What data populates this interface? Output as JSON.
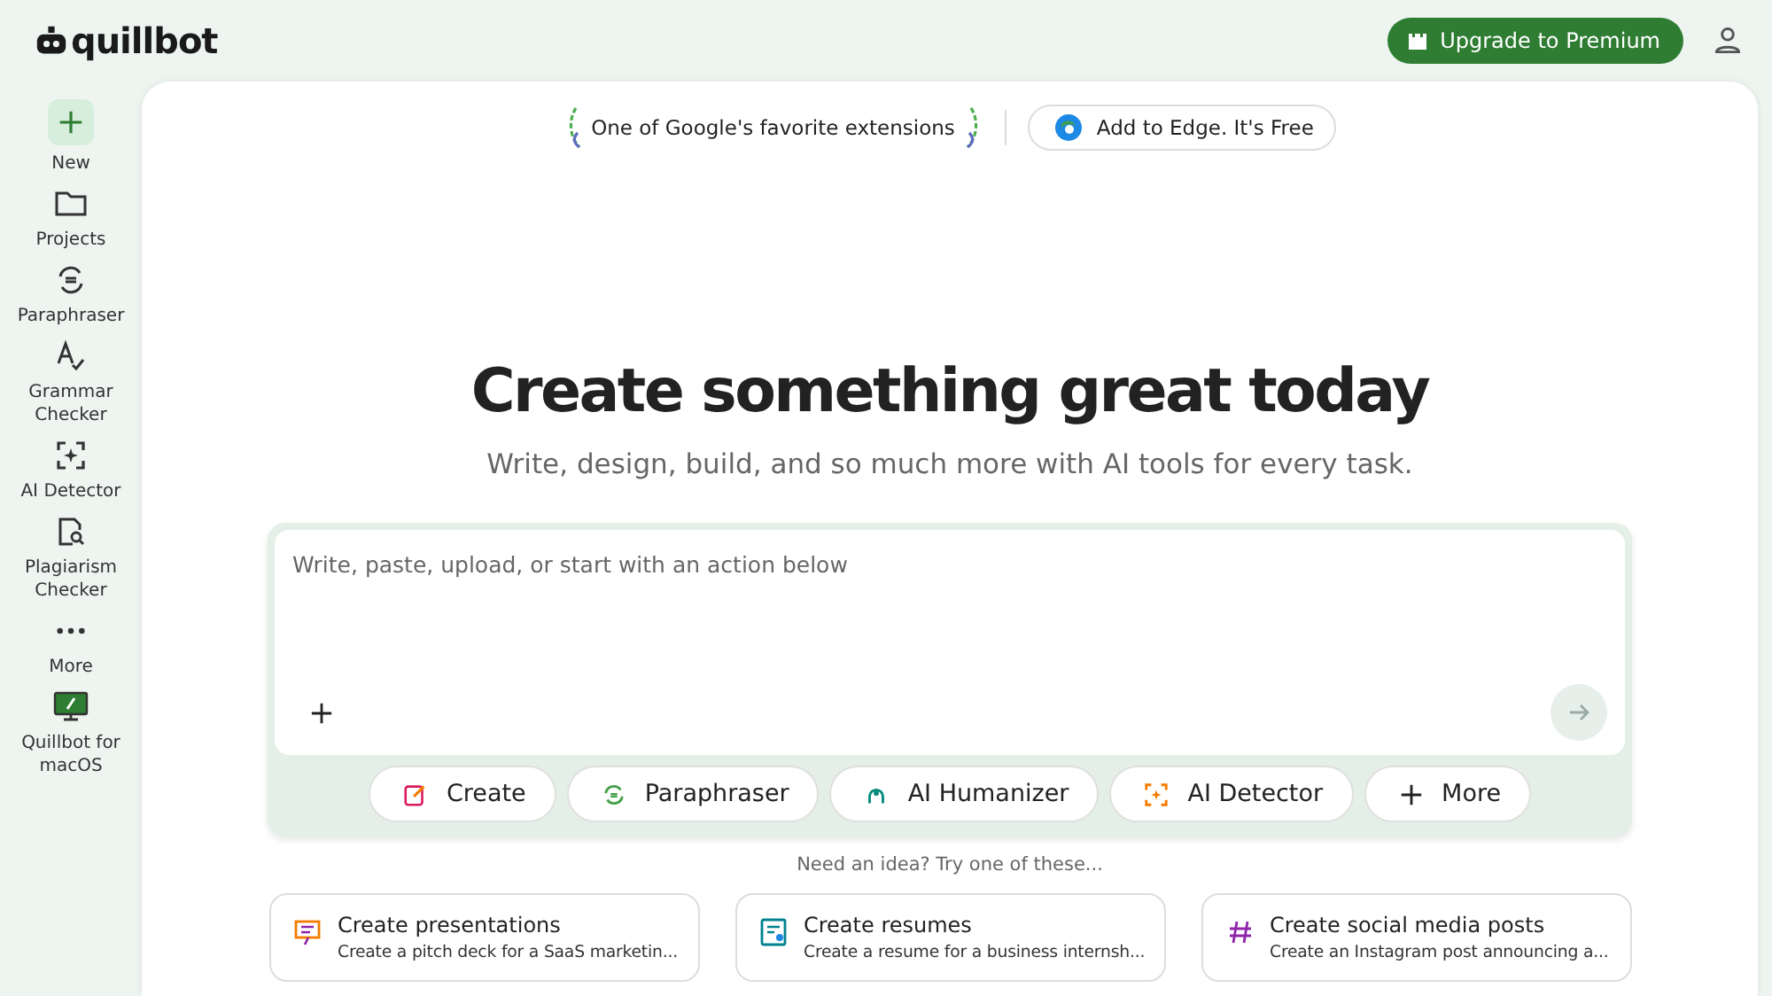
{
  "header": {
    "logo": "quillbot",
    "upgrade_button": "Upgrade to Premium"
  },
  "sidebar": {
    "items": [
      {
        "kind": "new",
        "label": "New"
      },
      {
        "kind": "folder",
        "label": "Projects"
      },
      {
        "kind": "paraphraser",
        "label": "Paraphraser"
      },
      {
        "kind": "grammar",
        "label": "Grammar Checker"
      },
      {
        "kind": "detector",
        "label": "AI Detector"
      },
      {
        "kind": "plagiarism",
        "label": "Plagiarism Checker"
      },
      {
        "kind": "more",
        "label": "More"
      },
      {
        "kind": "desktop",
        "label": "Quillbot for macOS"
      }
    ]
  },
  "banner": {
    "award": "One of Google's favorite extensions",
    "extension_button": "Add to Edge. It's Free"
  },
  "hero": {
    "title": "Create something great today",
    "subtitle": "Write, design, build, and so much more with AI tools for every task."
  },
  "prompt": {
    "placeholder": "Write, paste, upload, or start with an action below"
  },
  "actions": [
    {
      "kind": "create",
      "label": "Create"
    },
    {
      "kind": "paraphraser",
      "label": "Paraphraser"
    },
    {
      "kind": "humanizer",
      "label": "AI Humanizer"
    },
    {
      "kind": "detector",
      "label": "AI Detector"
    },
    {
      "kind": "more",
      "label": "More"
    }
  ],
  "suggestions": {
    "hint": "Need an idea? Try one of these...",
    "items": [
      {
        "kind": "presentation",
        "title": "Create presentations",
        "description": "Create a pitch deck for a SaaS marketin..."
      },
      {
        "kind": "resume",
        "title": "Create resumes",
        "description": "Create a resume for a business internsh..."
      },
      {
        "kind": "social",
        "title": "Create social media posts",
        "description": "Create an Instagram post announcing a..."
      }
    ]
  }
}
